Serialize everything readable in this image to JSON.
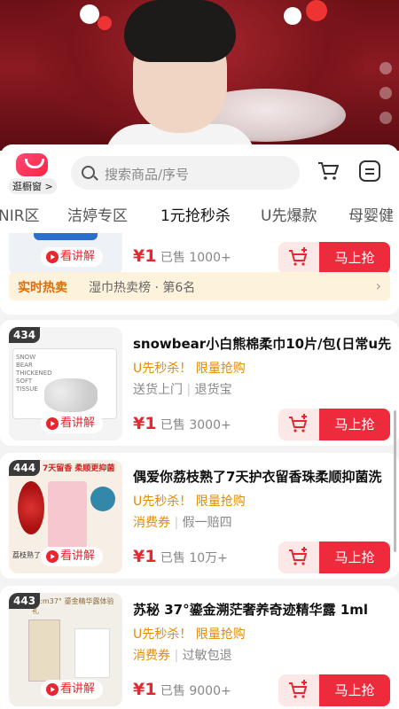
{
  "header": {
    "shop_label": "逛橱窗 >",
    "search_placeholder": "搜索商品/序号"
  },
  "categories": [
    "NIR区",
    "洁婷专区",
    "1元抢秒杀",
    "U先爆款",
    "母婴健"
  ],
  "active_category": "1元抢秒杀",
  "hot_banner": {
    "key": "实时热卖",
    "text": "湿巾热卖榜 · 第6名"
  },
  "explain_label": "看讲解",
  "buy_label": "马上抢",
  "products": [
    {
      "rank": "",
      "title": "",
      "promo": "",
      "tags": [],
      "price": "1",
      "sold": "已售 1000+"
    },
    {
      "rank": "434",
      "title": "snowbear小白熊棉柔巾10片/包(日常u先",
      "promo": "U先秒杀！ 限量抢购",
      "tags": [
        "送货上门",
        "退货宝"
      ],
      "price": "1",
      "sold": "已售 3000+"
    },
    {
      "rank": "444",
      "title": "偶爱你荔枝熟了7天护衣留香珠柔顺抑菌洗",
      "promo": "U先秒杀！ 限量抢购",
      "tags": [
        "消费券",
        "假一赔四"
      ],
      "price": "1",
      "sold": "已售 10万+"
    },
    {
      "rank": "443",
      "title": "苏秘 37°鎏金溯茫奢养奇迹精华露 1ml",
      "promo": "U先秒杀！ 限量抢购",
      "tags": [
        "消费券",
        "过敏包退"
      ],
      "price": "1",
      "sold": "已售 9000+"
    }
  ],
  "thumb_text": {
    "p1": "SNOW BEAR THICKENED SOFT TISSUE",
    "p2": "7天留香 柔顺更抑菌",
    "p2b": "荔枝熟了",
    "p3": "su:m37° 鎏金精华露体验礼"
  },
  "colors": {
    "accent": "#ee2b3c",
    "promo": "#e68a00"
  }
}
